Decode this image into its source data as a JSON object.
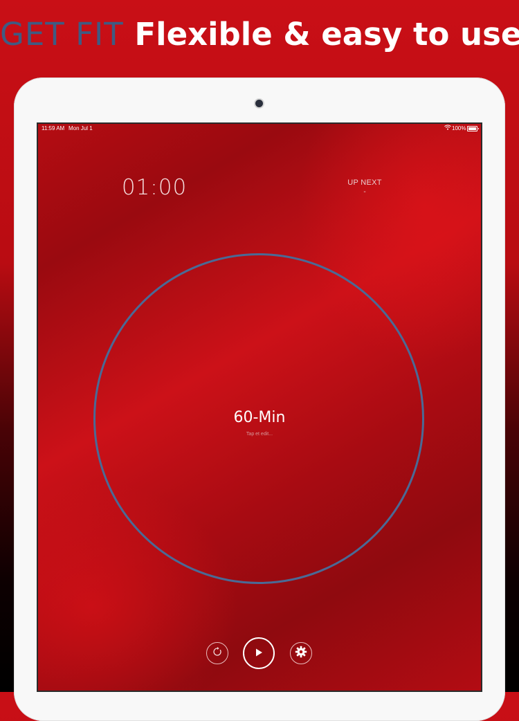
{
  "headline": {
    "brand": "GET FIT",
    "tagline": "Flexible & easy to use"
  },
  "status_bar": {
    "time": "11:59 AM",
    "date": "Mon Jul 1",
    "battery": "100%",
    "wifi_icon": "wifi-icon"
  },
  "timer": {
    "value": "01:00"
  },
  "up_next": {
    "label": "UP NEXT",
    "value": "-"
  },
  "dial": {
    "title": "60-Min",
    "hint": "Tap et edit..."
  },
  "controls": {
    "reset_icon": "reset-icon",
    "play_icon": "play-icon",
    "settings_icon": "gear-icon"
  },
  "colors": {
    "ring": "#4a6a96",
    "brand": "#3f5b83",
    "background": "#c90f16"
  }
}
